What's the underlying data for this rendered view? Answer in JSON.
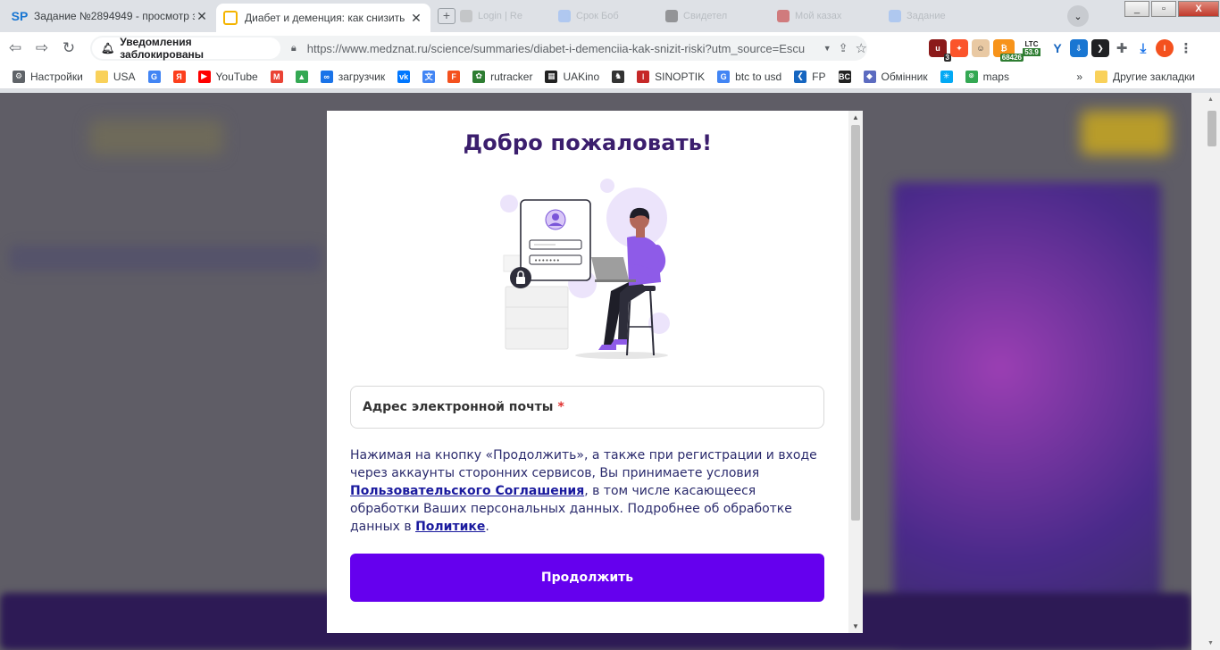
{
  "tabs": [
    {
      "label": "Задание №2894949 - просмотр з",
      "favicon": "SP"
    },
    {
      "label": "Диабет и деменция: как снизить",
      "favicon": "medznat"
    }
  ],
  "background_tabs": [
    "Login | Re",
    "Срок Боб",
    "Свидетел",
    "Мой казах",
    "Задание"
  ],
  "window": {
    "min": "_",
    "max": "▫",
    "close": "X"
  },
  "toolbar": {
    "notification": "Уведомления заблокированы",
    "url_host": "https://www.medznat.ru",
    "url_path": "/science/summaries/diabet-i-demenciia-kak-snizit-riski?utm_source=Escu",
    "ext_badges": {
      "counter": "3",
      "btc": "68426",
      "ltc_label": "LTC",
      "ltc_value": "53.9",
      "profile": "I"
    }
  },
  "bookmarks": [
    {
      "label": "Настройки",
      "icon": "gear-icon",
      "color": "#5f6368"
    },
    {
      "label": "USA",
      "icon": "folder-icon",
      "color": "#f9d15a"
    },
    {
      "label": "",
      "icon": "google-icon",
      "color": "#4285f4"
    },
    {
      "label": "",
      "icon": "yandex-icon",
      "color": "#fc3f1d"
    },
    {
      "label": "YouTube",
      "icon": "youtube-icon",
      "color": "#ff0000"
    },
    {
      "label": "",
      "icon": "gmail-icon",
      "color": "#ea4335"
    },
    {
      "label": "",
      "icon": "drive-icon",
      "color": "#34a853"
    },
    {
      "label": "загрузчик",
      "icon": "infinity-icon",
      "color": "#1a73e8"
    },
    {
      "label": "",
      "icon": "vk-icon",
      "color": "#0077ff"
    },
    {
      "label": "",
      "icon": "translate-icon",
      "color": "#4285f4"
    },
    {
      "label": "",
      "icon": "f-icon",
      "color": "#f4511e"
    },
    {
      "label": "rutracker",
      "icon": "rutracker-icon",
      "color": "#2e7d32"
    },
    {
      "label": "UAKino",
      "icon": "uakino-icon",
      "color": "#222222"
    },
    {
      "label": "",
      "icon": "chess-icon",
      "color": "#333333"
    },
    {
      "label": "SINOPTIK",
      "icon": "thermometer-icon",
      "color": "#c62828"
    },
    {
      "label": "btc to usd",
      "icon": "google-icon",
      "color": "#4285f4"
    },
    {
      "label": "FP",
      "icon": "fp-icon",
      "color": "#1565c0"
    },
    {
      "label": "",
      "icon": "bc-icon",
      "color": "#222222"
    },
    {
      "label": "Обмінник",
      "icon": "exchange-icon",
      "color": "#5c6bc0"
    },
    {
      "label": "",
      "icon": "star-spark-icon",
      "color": "#03a9f4"
    },
    {
      "label": "maps",
      "icon": "maps-icon",
      "color": "#34a853"
    }
  ],
  "bookmarks_more": "»",
  "bookmarks_other": "Другие закладки",
  "modal": {
    "title": "Добро пожаловать!",
    "email_label": "Адрес электронной почты",
    "required_mark": "*",
    "terms_1": "Нажимая на кнопку «Продолжить», а также при регистрации и входе через аккаунты сторонних сервисов, Вы принимаете условия ",
    "terms_link_1": "Пользовательского Соглашения",
    "terms_2": ", в том числе касающееся обработки Ваших персональных данных. Подробнее об обработке данных в ",
    "terms_link_2": "Политике",
    "terms_3": ".",
    "continue_label": "Продолжить"
  },
  "colors": {
    "accent": "#6500ee",
    "title": "#3b1e6d",
    "link": "#1a1a9e",
    "required": "#e0312f"
  }
}
